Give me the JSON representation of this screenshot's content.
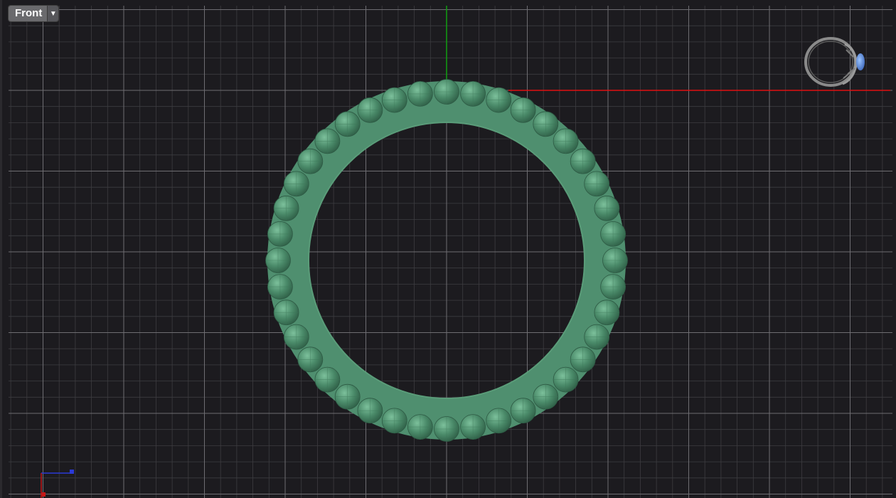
{
  "viewport": {
    "name": "Front",
    "dropdown_icon": "triangle-down-icon"
  },
  "colors": {
    "background": "#1c1b1f",
    "grid_minor": "#3d3c40",
    "grid_major": "#6e6d72",
    "x_axis": "#e01010",
    "y_axis": "#10a010",
    "ring": "#4f8f6f",
    "ring_highlight": "#64a582"
  },
  "icons": {
    "preview": "ring-preview-icon",
    "axes": "world-axes-icon"
  }
}
